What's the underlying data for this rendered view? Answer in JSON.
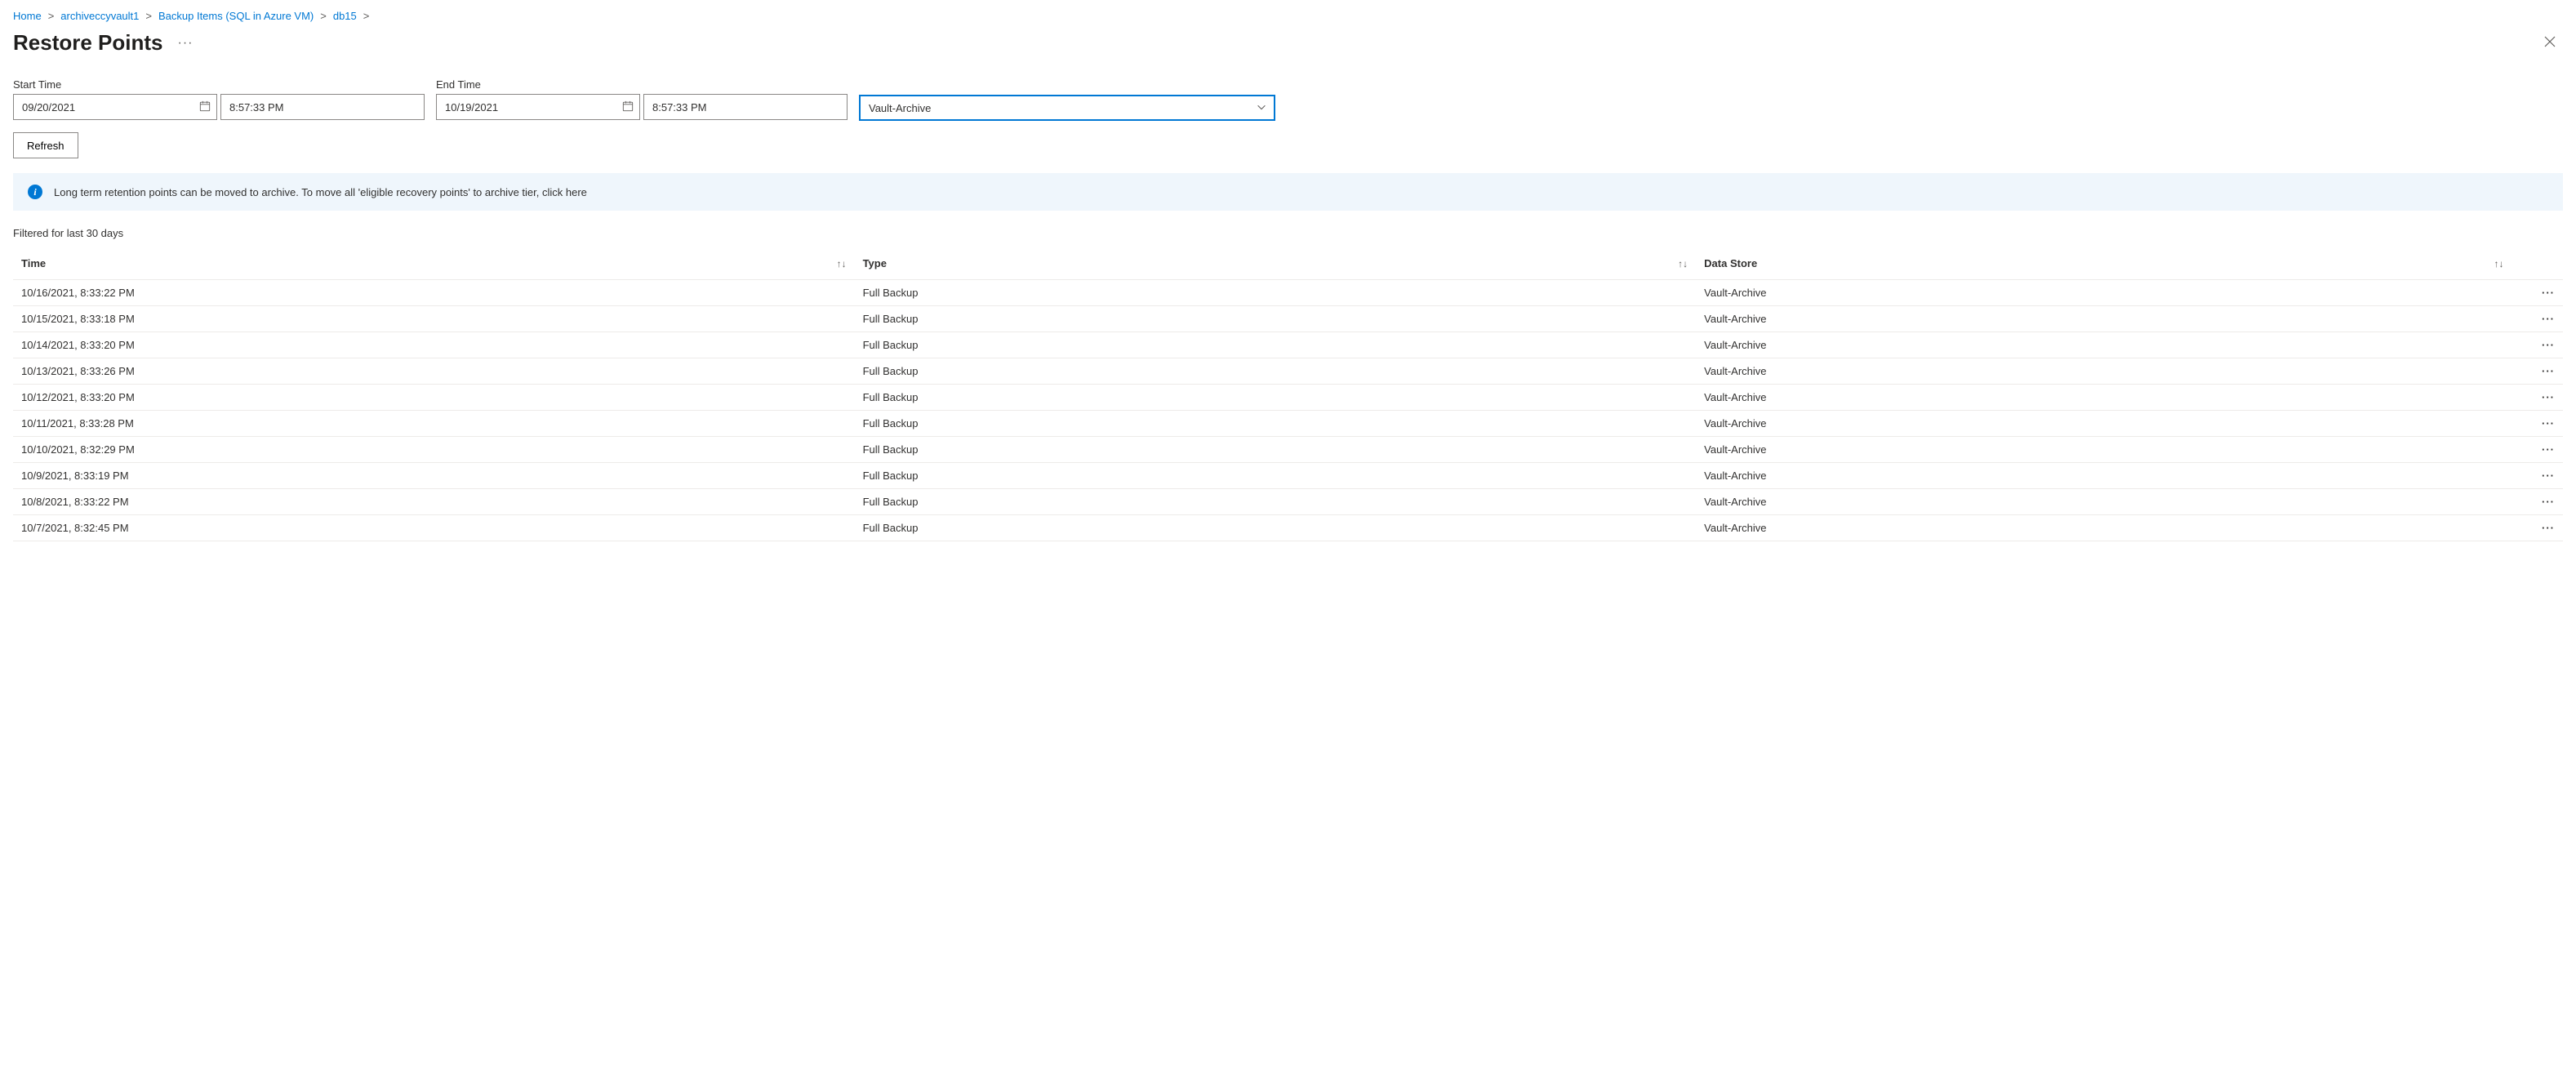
{
  "breadcrumb": [
    {
      "label": "Home"
    },
    {
      "label": "archiveccyvault1"
    },
    {
      "label": "Backup Items (SQL in Azure VM)"
    },
    {
      "label": "db15"
    }
  ],
  "page_title": "Restore Points",
  "filters": {
    "start_label": "Start Time",
    "start_date": "09/20/2021",
    "start_time": "8:57:33 PM",
    "end_label": "End Time",
    "end_date": "10/19/2021",
    "end_time": "8:57:33 PM",
    "tier_value": "Vault-Archive"
  },
  "buttons": {
    "refresh": "Refresh"
  },
  "info_bar": {
    "text": "Long term retention points can be moved to archive. To move all 'eligible recovery points' to archive tier, click here"
  },
  "filtered_label": "Filtered for last 30 days",
  "columns": {
    "time": "Time",
    "type": "Type",
    "data_store": "Data Store"
  },
  "rows": [
    {
      "time": "10/16/2021, 8:33:22 PM",
      "type": "Full Backup",
      "data_store": "Vault-Archive"
    },
    {
      "time": "10/15/2021, 8:33:18 PM",
      "type": "Full Backup",
      "data_store": "Vault-Archive"
    },
    {
      "time": "10/14/2021, 8:33:20 PM",
      "type": "Full Backup",
      "data_store": "Vault-Archive"
    },
    {
      "time": "10/13/2021, 8:33:26 PM",
      "type": "Full Backup",
      "data_store": "Vault-Archive"
    },
    {
      "time": "10/12/2021, 8:33:20 PM",
      "type": "Full Backup",
      "data_store": "Vault-Archive"
    },
    {
      "time": "10/11/2021, 8:33:28 PM",
      "type": "Full Backup",
      "data_store": "Vault-Archive"
    },
    {
      "time": "10/10/2021, 8:32:29 PM",
      "type": "Full Backup",
      "data_store": "Vault-Archive"
    },
    {
      "time": "10/9/2021, 8:33:19 PM",
      "type": "Full Backup",
      "data_store": "Vault-Archive"
    },
    {
      "time": "10/8/2021, 8:33:22 PM",
      "type": "Full Backup",
      "data_store": "Vault-Archive"
    },
    {
      "time": "10/7/2021, 8:32:45 PM",
      "type": "Full Backup",
      "data_store": "Vault-Archive"
    }
  ]
}
